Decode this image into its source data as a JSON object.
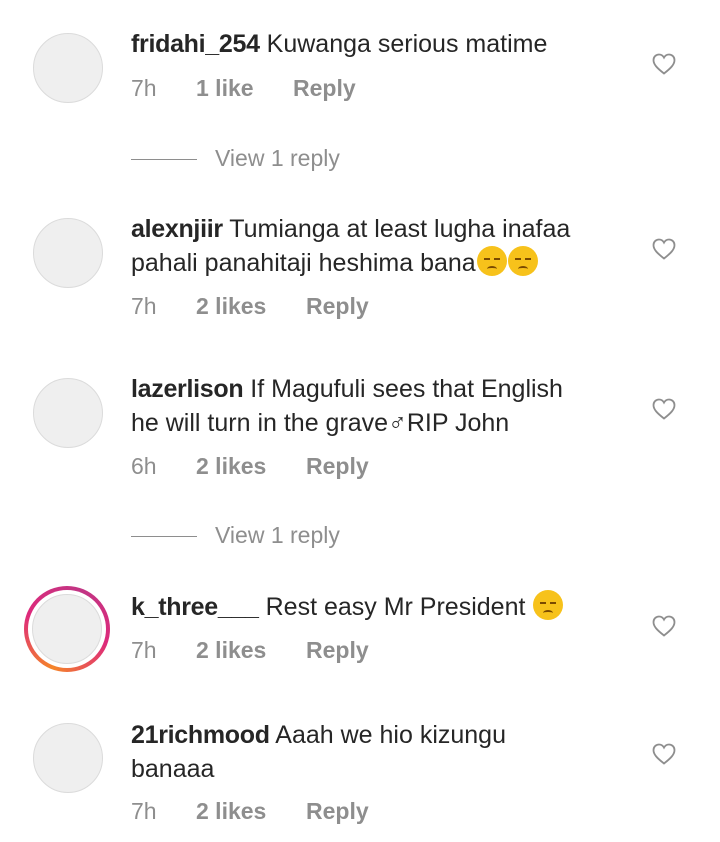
{
  "comments": [
    {
      "username": "fridahi_254",
      "text": "Kuwanga serious matime",
      "text_line2": "",
      "emojis": 0,
      "time": "7h",
      "likes": "1 like",
      "reply": "Reply",
      "view_replies": "View 1 reply"
    },
    {
      "username": "alexnjiir",
      "text": "Tumianga at least lugha inafaa",
      "text_line2": "pahali panahitaji heshima bana",
      "emojis": 2,
      "time": "7h",
      "likes": "2 likes",
      "reply": "Reply"
    },
    {
      "username": "lazerlison",
      "text": "If Magufuli sees that English",
      "text_line2": "he will turn in the grave♂RIP John",
      "emojis": 0,
      "time": "6h",
      "likes": "2 likes",
      "reply": "Reply",
      "view_replies": "View 1 reply"
    },
    {
      "username": "k_three___",
      "text": "Rest easy Mr President",
      "text_line2": "",
      "emojis": 1,
      "time": "7h",
      "likes": "2 likes",
      "reply": "Reply"
    },
    {
      "username": "21richmood",
      "text": "Aaah we hio kizungu",
      "text_line2": "banaaa",
      "emojis": 0,
      "time": "7h",
      "likes": "2 likes",
      "reply": "Reply"
    }
  ],
  "colors": {
    "text": "#262626",
    "muted": "#8e8e8e",
    "story_ring": "#dd2a7b"
  },
  "icons": {
    "like": "heart-outline-icon"
  }
}
